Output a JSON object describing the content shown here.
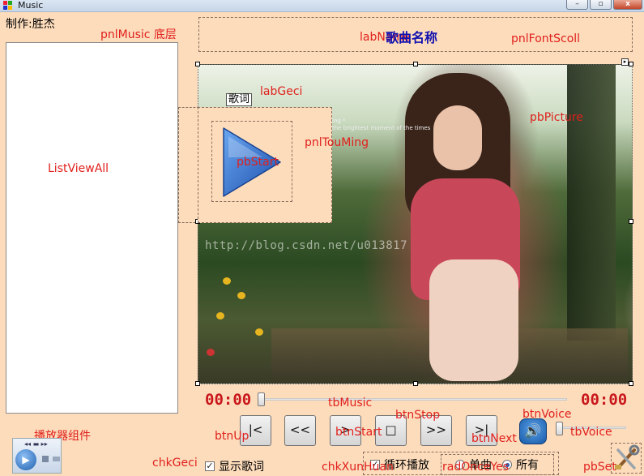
{
  "window": {
    "title": "Music",
    "minimize_glyph": "–",
    "maximize_glyph": "▫",
    "close_glyph": "x"
  },
  "header": {
    "maker": "制作:胜杰",
    "song_title": "歌曲名称"
  },
  "design_labels": {
    "pnlMusic": "pnlMusic 底层",
    "labName": "labName",
    "pnlFontScoll": "pnlFontScoll",
    "labGeci": "labGeci",
    "pbPicture": "pbPicture",
    "pnlTouMing": "pnlTouMing",
    "pbStart": "pbStart",
    "listViewAll": "ListViewAll",
    "tbMusic": "tbMusic",
    "btnStop": "btnStop",
    "btnVoice": "btnVoice",
    "tbVoice": "tbVoice",
    "player_component": "播放器组件",
    "btnUp": "btnUp",
    "btnStart": "btnStart",
    "btnNext": "btnNext",
    "chkGeci": "chkGeci",
    "chkXunHuan": "chkXunHuan",
    "radOnceYes": "radOnceYes",
    "pbSet": "pbSet"
  },
  "lyrics_label": "歌词",
  "watermark": "http://blog.csdn.net/u013817",
  "photo_text": [
    "ing *",
    "the brightest moment of the times"
  ],
  "time": {
    "current": "00:00",
    "total": "00:00"
  },
  "progress": {
    "music": 0.0,
    "volume": 0.0
  },
  "controls": {
    "first": "|<",
    "prev": "<<",
    "play": ">",
    "stop": "□",
    "next": ">>",
    "last": ">|",
    "voice": "🔊"
  },
  "options": {
    "show_lyrics": {
      "label": "显示歌词",
      "checked": true
    },
    "loop_play": {
      "label": "循环播放",
      "checked": true
    },
    "play_mode": {
      "single": {
        "label": "单曲",
        "selected": false
      },
      "all": {
        "label": "所有",
        "selected": true
      }
    }
  },
  "colors": {
    "form_background": "#fddcbc",
    "design_label": "#e0201c",
    "song_title": "#1212b0",
    "time_text": "#c9161a",
    "play_button": "#3a78d6"
  }
}
